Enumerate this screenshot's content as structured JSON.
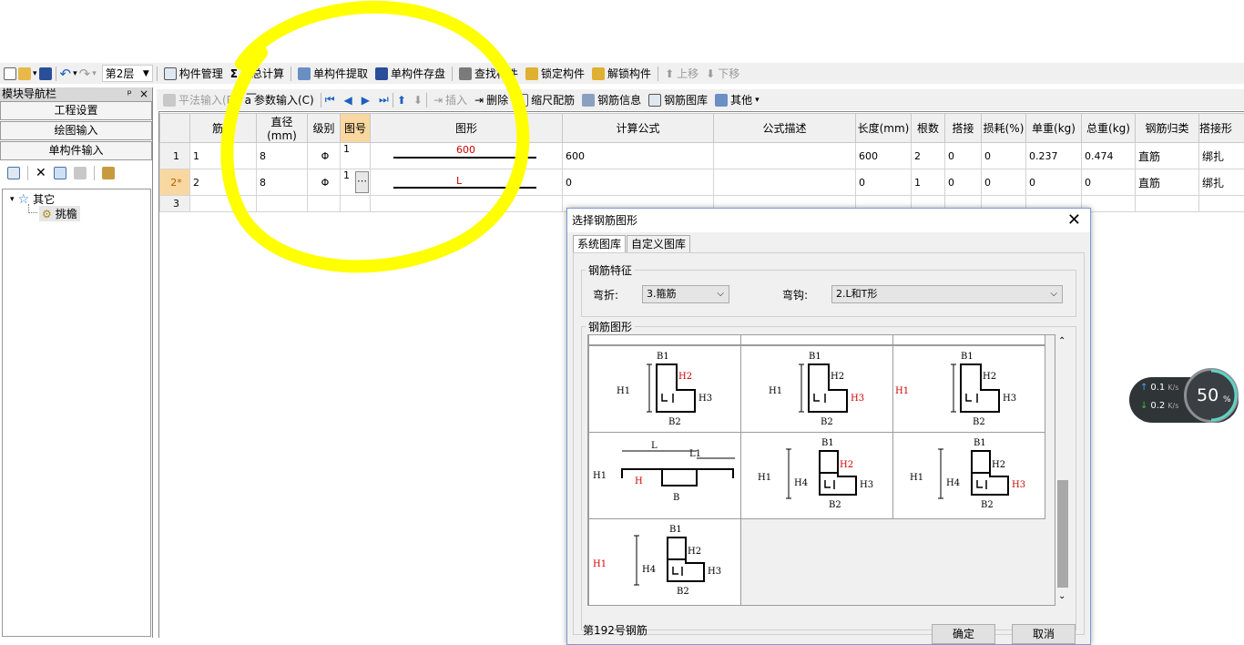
{
  "toolbar1": {
    "floor": "第2层",
    "items": [
      "构件管理",
      "汇总计算",
      "单构件提取",
      "单构件存盘",
      "查找构件",
      "锁定构件",
      "解锁构件",
      "上移",
      "下移"
    ]
  },
  "toolbar2": {
    "items": [
      "平法输入(P)",
      "参数输入(C)",
      "插入",
      "删除",
      "缩尺配筋",
      "钢筋信息",
      "钢筋图库",
      "其他"
    ]
  },
  "sidebar": {
    "title": "模块导航栏",
    "pin": "ᵖ",
    "close": "×",
    "buttons": [
      "工程设置",
      "绘图输入",
      "单构件输入"
    ],
    "tree_root": "其它",
    "tree_child": "挑檐"
  },
  "grid": {
    "headers": [
      "",
      "筋号",
      "直径(mm)",
      "级别",
      "图号",
      "图形",
      "计算公式",
      "公式描述",
      "长度(mm)",
      "根数",
      "搭接",
      "损耗(%)",
      "单重(kg)",
      "总重(kg)",
      "钢筋归类",
      "搭接形"
    ],
    "rows": [
      [
        "1",
        "1",
        "8",
        "Φ",
        "1",
        "600",
        "600",
        "",
        "600",
        "2",
        "0",
        "0",
        "0.237",
        "0.474",
        "直筋",
        "绑扎"
      ],
      [
        "2*",
        "2",
        "8",
        "Φ",
        "1",
        "L",
        "0",
        "",
        "0",
        "1",
        "0",
        "0",
        "0",
        "0",
        "直筋",
        "绑扎"
      ],
      [
        "3",
        "",
        "",
        "",
        "",
        "",
        "",
        "",
        "",
        "",
        "",
        "",
        "",
        "",
        "",
        ""
      ]
    ]
  },
  "dialog": {
    "title": "选择钢筋图形",
    "close": "✕",
    "tabs": [
      "系统图库",
      "自定义图库"
    ],
    "feature_group": "钢筋特征",
    "bend_label": "弯折:",
    "bend_value": "3.箍筋",
    "hook_label": "弯钩:",
    "hook_value": "2.L和T形",
    "shape_group": "钢筋图形",
    "status": "第192号钢筋",
    "ok": "确定",
    "cancel": "取消",
    "cells": [
      {
        "labels": [
          "B1",
          "H1",
          "H2",
          "H3",
          "B2"
        ],
        "red": "H2"
      },
      {
        "labels": [
          "B1",
          "H1",
          "H2",
          "H3",
          "B2"
        ],
        "red": "H3"
      },
      {
        "labels": [
          "B1",
          "H1",
          "H2",
          "H3",
          "B2"
        ],
        "red": "H1"
      },
      {
        "labels": [
          "L",
          "L1",
          "H1",
          "H",
          "B"
        ],
        "red": "H"
      },
      {
        "labels": [
          "B1",
          "H1",
          "H4",
          "H2",
          "H3",
          "B2"
        ],
        "red": "H2"
      },
      {
        "labels": [
          "B1",
          "H1",
          "H4",
          "H2",
          "H3",
          "B2"
        ],
        "red": "H3"
      },
      {
        "labels": [
          "B1",
          "H1",
          "H4",
          "H2",
          "H3",
          "B2"
        ],
        "red": "H1"
      }
    ]
  },
  "netspeed": {
    "up": "0.1",
    "down": "0.2",
    "unit": "K/s",
    "percent": "50",
    "pct_sign": "%"
  },
  "colors": {
    "highlight": "#ffff00",
    "accent_red": "#d00000",
    "selected_header": "#f8d8a0"
  }
}
